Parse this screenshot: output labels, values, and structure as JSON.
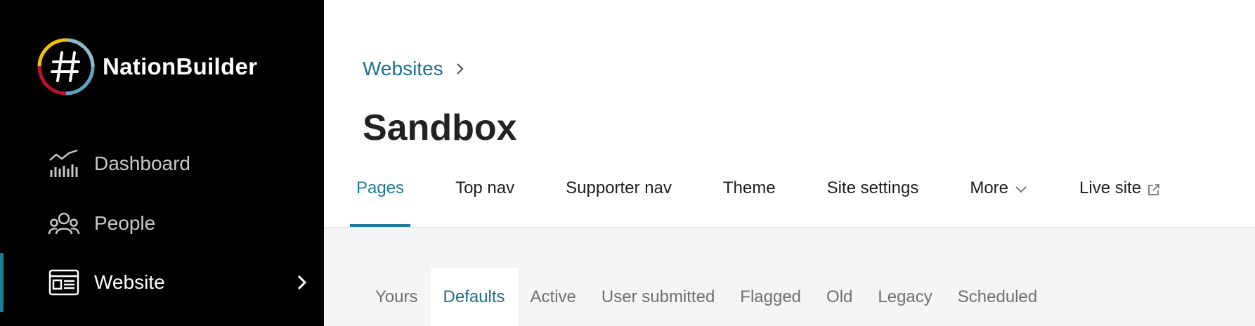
{
  "brand": {
    "name": "NationBuilder"
  },
  "sidebar": {
    "items": [
      {
        "label": "Dashboard",
        "icon": "chart-icon"
      },
      {
        "label": "People",
        "icon": "people-icon"
      },
      {
        "label": "Website",
        "icon": "website-icon",
        "active": true
      }
    ]
  },
  "breadcrumb": {
    "items": [
      "Websites"
    ]
  },
  "page": {
    "title": "Sandbox"
  },
  "tabs": [
    {
      "label": "Pages",
      "active": true
    },
    {
      "label": "Top nav"
    },
    {
      "label": "Supporter nav"
    },
    {
      "label": "Theme"
    },
    {
      "label": "Site settings"
    },
    {
      "label": "More",
      "icon": "chevron-down-icon"
    },
    {
      "label": "Live site",
      "icon": "external-link-icon"
    }
  ],
  "subtabs": [
    {
      "label": "Yours"
    },
    {
      "label": "Defaults",
      "active": true
    },
    {
      "label": "Active"
    },
    {
      "label": "User submitted"
    },
    {
      "label": "Flagged"
    },
    {
      "label": "Old"
    },
    {
      "label": "Legacy"
    },
    {
      "label": "Scheduled"
    }
  ],
  "colors": {
    "accent": "#1d7a99",
    "sidebar_bg": "#000000",
    "content_bg": "#f4f5f7"
  }
}
